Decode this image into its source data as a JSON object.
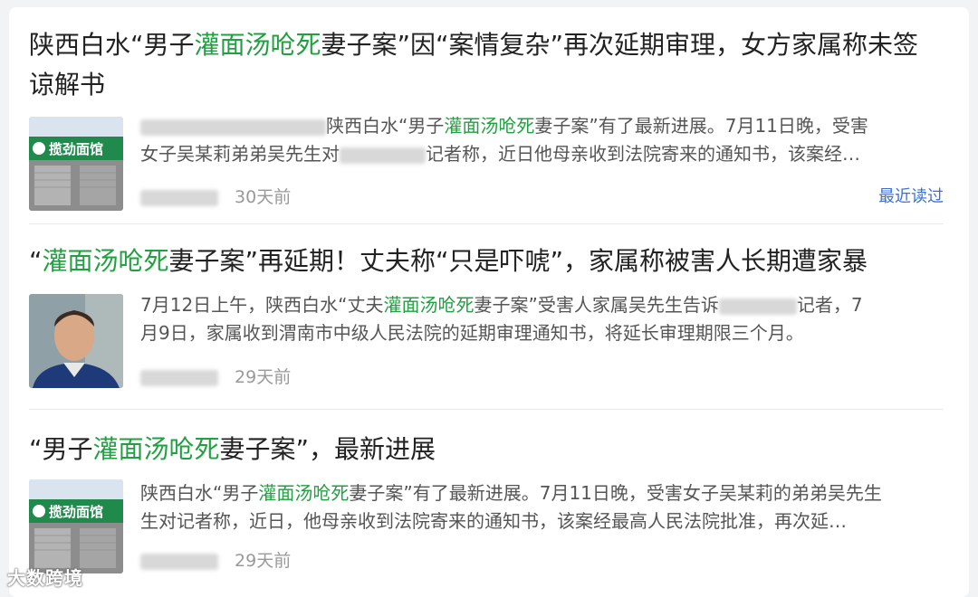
{
  "articles": [
    {
      "title_parts": [
        "陕西白水“男子",
        "灌面汤呛死",
        "妻子案”因“案情复杂”再次延期审理，女方家属称未签",
        "谅解书"
      ],
      "snippet_parts": [
        "陕西白水“男子",
        "灌面汤呛死",
        "妻子案”有了最新进展。7月11日晚，受害",
        "女子吴某莉弟弟吴先生对",
        "记者称，近日他母亲收到法院寄来的通知书，该案经…"
      ],
      "time": "30天前",
      "recent_label": "最近读过",
      "thumb_sign": "揽劲面馆"
    },
    {
      "title_parts": [
        "“",
        "灌面汤呛死",
        "妻子案”再延期！丈夫称“只是吓唬”，家属称被害人长期遭家暴"
      ],
      "snippet_parts": [
        "7月12日上午，陕西白水“丈夫",
        "灌面汤呛死",
        "妻子案”受害人家属吴先生告诉",
        "记者，7",
        "月9日，家属收到渭南市中级人民法院的延期审理通知书，将延长审理期限三个月。"
      ],
      "time": "29天前"
    },
    {
      "title_parts": [
        "“男子",
        "灌面汤呛死",
        "妻子案”，最新进展"
      ],
      "snippet_parts": [
        "陕西白水“男子",
        "灌面汤呛死",
        "妻子案”有了最新进展。7月11日晚，受害女子吴某莉的弟弟吴先生",
        "生对记者称，近日，他母亲收到法院寄来的通知书，该案经最高人民法院批准，再次延…"
      ],
      "time": "29天前",
      "thumb_sign": "揽劲面馆"
    }
  ],
  "watermark": "大数跨境",
  "colors": {
    "highlight": "#21a041",
    "link": "#3a6fd8"
  }
}
